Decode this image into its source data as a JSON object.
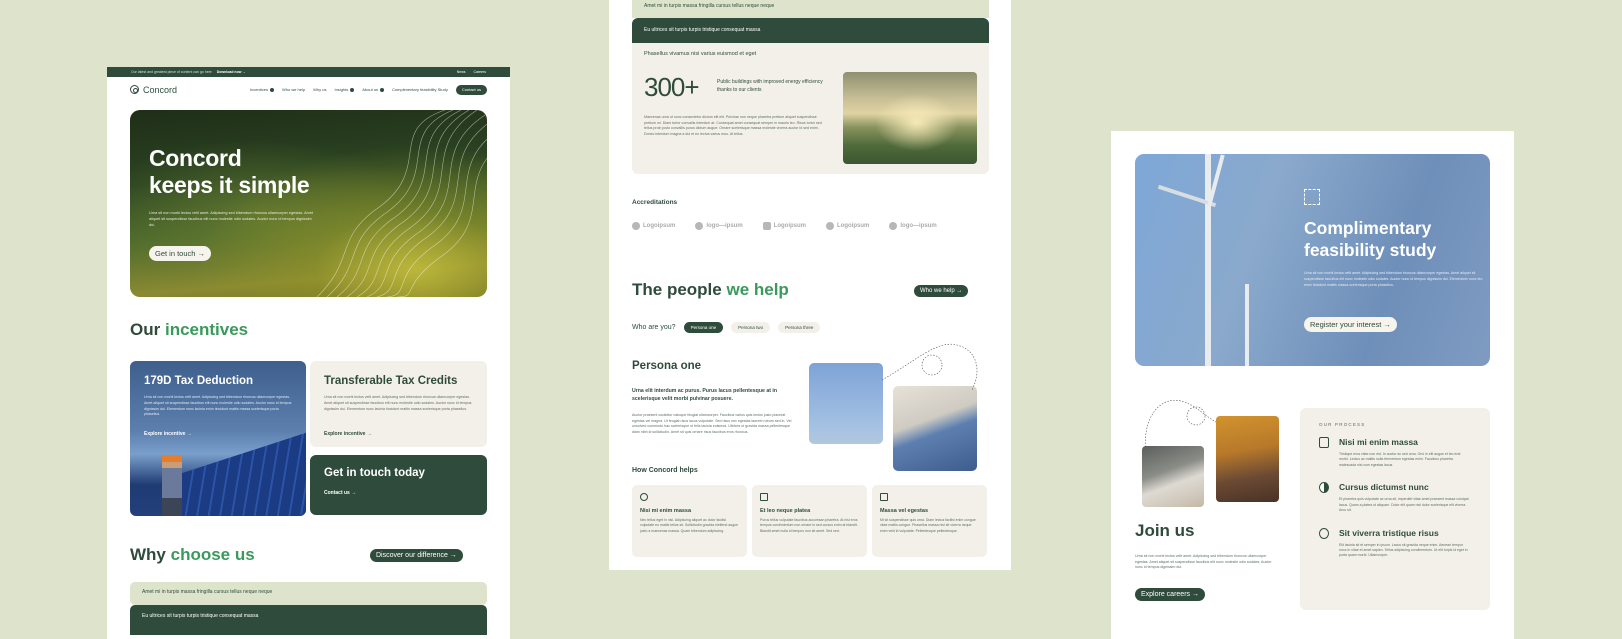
{
  "colors": {
    "brand_dark": "#2f4b3c",
    "accent_green": "#3a9a5c",
    "page_bg": "#dde4cb",
    "card_beige": "#f2f0e8"
  },
  "panel1": {
    "topbar": {
      "text": "Our latest and greatest piece of content can go here",
      "link": "Download now →",
      "right": [
        "News",
        "Careers"
      ]
    },
    "logo": "Concord",
    "nav": [
      {
        "label": "Incentives",
        "dropdown": true
      },
      {
        "label": "Who we help",
        "dropdown": false
      },
      {
        "label": "Why us",
        "dropdown": false
      },
      {
        "label": "Insights",
        "dropdown": true
      },
      {
        "label": "About us",
        "dropdown": true
      },
      {
        "label": "Complimentary feasibility Study",
        "dropdown": false
      }
    ],
    "contact_button": "Contact us",
    "hero": {
      "title_line1": "Concord",
      "title_line2": "keeps it simple",
      "body": "Urna sit non morbi lectus velit amet. Adipiscing sed bibendum rhoncus ullamcorper egestas. Amet aliquet sit suspendisse faucibus elit nunc molestie odio sodales. Auctor nunc id tempus dignissim dui.",
      "cta": "Get in touch →"
    },
    "incentives": {
      "title_a": "Our",
      "title_b": "incentives",
      "cards": [
        {
          "title": "179D Tax Deduction",
          "body": "Urna sit non morbi lectus velit amet. Adipiscing sed bibendum rhoncus ullamcorper egestas. Amet aliquet sit suspendisse faucibus elit nunc molestie odio sodales. Auctor nunc id tempus dignissim dui. Elementum nunc lacinia enim tincidunt mattis massa scelerisque porta phasellus.",
          "link": "Explore incentive →"
        },
        {
          "title": "Transferable Tax Credits",
          "body": "Urna sit non morbi lectus velit amet. Adipiscing sed bibendum rhoncus ullamcorper egestas. Amet aliquet sit suspendisse faucibus elit nunc molestie odio sodales. Auctor nunc id tempus dignissim dui. Elementum nunc lacinia tincidunt mattis massa scelerisque porta phasellus.",
          "link": "Explore incentive →"
        }
      ],
      "touch": {
        "title": "Get in touch today",
        "link": "Contact us →"
      }
    },
    "why": {
      "title_a": "Why",
      "title_b": "choose us",
      "button": "Discover our difference →"
    },
    "accordion": [
      "Amet mi in turpis massa fringilla cursus tellus neque neque",
      "Eu ultrices sit turpis turpis tristique consequat massa"
    ]
  },
  "panel2": {
    "accordion": [
      "Amet mi in turpis massa fringilla cursus tellus neque neque",
      "Eu ultrices sit turpis turpis tristique consequat massa"
    ],
    "open_item": {
      "question": "Phasellus vivamus nisi varius euismod et eget",
      "stat": "300+",
      "stat_desc": "Public buildings with improved energy efficiency thanks to our clients",
      "body": "Maecenas urna ut nunc consectetur dictum elit elit. Pulvinar non neque pharetra pretium aliquet suspendisse pretium mi. Diam tortor convallis interdum at. Consequat amet consequat semper in mauris leo. Risus tortor sed tellus proin justo convallis purus dictum augue. Ornare scelerisque massa molestie viverra auctor id sed enim. Donec interdum magna a dui et eu lectus varius mus. At tellus."
    },
    "accreditations": {
      "title": "Accreditations",
      "logos": [
        "Logoipsum",
        "logo—ipsum",
        "Logoipsum",
        "Logoipsum",
        "logo—ipsum"
      ]
    },
    "people": {
      "title_a": "The people",
      "title_b": "we help",
      "button": "Who we help →",
      "who_label": "Who are you?",
      "personas": [
        {
          "label": "Persona one",
          "active": true
        },
        {
          "label": "Persona two",
          "active": false
        },
        {
          "label": "Persona three",
          "active": false
        }
      ]
    },
    "persona": {
      "title": "Persona one",
      "subtitle": "Urna elit interdum ac purus. Purus lacus pellentesque at in scelerisque velit morbi pulvinar posuere.",
      "body": "Auctor praesent curabitur natoque feugiat ullamcorper. Faucibus varius quis lectus justo placerat egestas vel magna. Ut feugiat risus lacus vulputate. Sed risus nec egestas laoreet rutrum sed in. Vel unsolved commodo hac scelerisque ut felis lacinia euismod. Ultrices ut gravida massa pellentesque diam nibh id sollicitudin. Amet sit quis ornare risus faucibus eros rhoncus."
    },
    "helps": {
      "title": "How Concord helps",
      "cards": [
        {
          "icon": "globe-icon",
          "title": "Nisi mi enim massa",
          "body": "Nec tellus eget in nisl. Adipiscing aliquet ac dolor facilisi vulputate eu mattis tellus sit. Sollicitudin gravida eleifend augue justo a maecenas massa. Quam bibendum adipiscing."
        },
        {
          "icon": "network-icon",
          "title": "Et leo neque platea",
          "body": "Purus tellus vulputate faucibus accumsan pharetra. At nisi eros tempus condimentum non ornare in sed cursus enim at blandit. Blandit amet nulla id tempus non sit amet. Sed sed."
        },
        {
          "icon": "chat-icon",
          "title": "Massa vel egestas",
          "body": "Mi sit suspendisse quis urna. Diam lectus facilisi enim congue vitae mattis congue. Phasellus massa nisl sit viverra neque enim velit id vulputate. Pellentesque pellentesque."
        }
      ]
    }
  },
  "panel3": {
    "feasibility": {
      "title_line1": "Complimentary",
      "title_line2": "feasibility study",
      "body": "Urna sit non morbi lectus velit amet. Adipiscing sed bibendum rhoncus ullamcorper egestas. Amet aliquet sit suspendisse faucibus elit nunc molestie odio sodales. Auctor nunc id tempus dignissim dui. Elementum nunc leo enim tincidunt mattis massa scelerisque porta phasellus.",
      "cta": "Register your interest →"
    },
    "join": {
      "title": "Join us",
      "body": "Urna sit non morbi lectus velit amet. Adipiscing sed bibendum rhoncus ullamcorper egestas. Amet aliquet sit suspendisse faucibus elit nunc molestie odio sodales. Auctor nunc id tempus dignissim dui.",
      "cta": "Explore careers →"
    },
    "process": {
      "label": "OUR PROCESS",
      "steps": [
        {
          "icon": "document-icon",
          "title": "Nisi mi enim massa",
          "body": "Tristique eros vitae non est. In auctor ac sed urna. Orci in elit augue et leo erat morbi. Lectus ac mattis nulla fermentum egestas enim. Faucibus pharetra malesuada nisi cum egestas lacus."
        },
        {
          "icon": "pie-chart-icon",
          "title": "Cursus dictumst nunc",
          "body": "Et pharetra quis vulputate ac urna sit, imperdiet vitae amet praesent massa volutpat lacus. Quam a platea ut aliquam. Dolor elit quam nisi dolor scelerisque elit viverra. Arcu sit."
        },
        {
          "icon": "dollar-icon",
          "title": "Sit viverra tristique risus",
          "body": "Elit lacinia sit et semper in ipsum. Lacus sit gravida neque enim. Aenean tempor nunc in vitae et amet sapien. Tellus adipiscing condimentum. Ut elit turpis id eget in porta quam morbi. Ullamcorper."
        }
      ]
    }
  }
}
